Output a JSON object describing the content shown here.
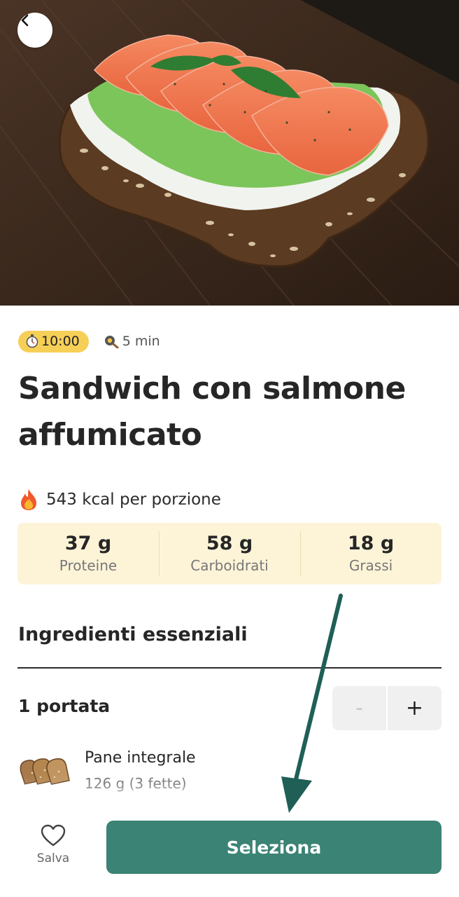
{
  "recipe": {
    "time_badge": "10:00",
    "prep_time": "5 min",
    "title": "Sandwich con salmone affumicato",
    "calories": "543 kcal per porzione"
  },
  "macros": [
    {
      "value": "37 g",
      "label": "Proteine"
    },
    {
      "value": "58 g",
      "label": "Carboidrati"
    },
    {
      "value": "18 g",
      "label": "Grassi"
    }
  ],
  "ingredients_section": {
    "title": "Ingredienti essenziali",
    "servings": "1 portata",
    "stepper": {
      "minus": "-",
      "plus": "+"
    },
    "items": [
      {
        "name": "Pane integrale",
        "quantity": "126 g (3 fette)"
      }
    ]
  },
  "bottom_bar": {
    "save_label": "Salva",
    "select_label": "Seleziona"
  },
  "colors": {
    "accent": "#3b8374",
    "badge": "#f6cf57",
    "macro_bg": "#fdf4d8",
    "annotation_arrow": "#1f5f56"
  },
  "icons": {
    "back": "chevron-left-icon",
    "timer": "stopwatch-icon",
    "prep": "pan-icon",
    "calories": "fire-icon",
    "save": "heart-icon"
  }
}
